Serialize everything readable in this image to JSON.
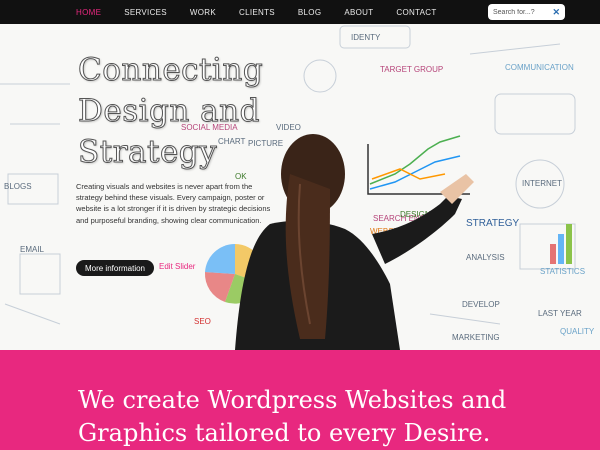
{
  "nav": {
    "items": [
      {
        "label": "HOME",
        "active": true
      },
      {
        "label": "SERVICES",
        "active": false
      },
      {
        "label": "WORK",
        "active": false
      },
      {
        "label": "CLIENTS",
        "active": false
      },
      {
        "label": "BLOG",
        "active": false
      },
      {
        "label": "ABOUT",
        "active": false
      },
      {
        "label": "CONTACT",
        "active": false
      }
    ],
    "search": {
      "placeholder": "Search for...?",
      "clear_icon": "close-icon"
    }
  },
  "hero": {
    "title": "Connecting Design and Strategy",
    "body": "Creating visuals and websites is never apart from the strategy behind these visuals. Every campaign, poster or website is a lot stronger if it is driven by strategic decisions and purposeful branding, showing clear communication.",
    "button_label": "More information",
    "edit_link": "Edit Slider",
    "whiteboard_words": {
      "identity": "IDENTY",
      "target_group": "TARGET GROUP",
      "communication": "COMMUNICATION",
      "social_media": "SOCIAL MEDIA",
      "video": "VIDEO",
      "chart": "CHART",
      "picture": "PICTURE",
      "blogs": "BLOGS",
      "ok": "OK",
      "research": "SEARCH ENGINE",
      "design": "DESIGN",
      "website": "WEBSITE",
      "strategy": "STRATEGY",
      "analysis": "ANALYSIS",
      "develop": "DEVELOP",
      "marketing": "MARKETING",
      "internet": "INTERNET",
      "statistics": "STATISTICS",
      "quality": "QUALITY",
      "seo": "SEO",
      "last_year": "LAST YEAR",
      "email": "EMAIL"
    }
  },
  "band": {
    "text": "We create Wordpress Websites and Graphics tailored to every Desire."
  },
  "colors": {
    "accent": "#e8287f",
    "nav_bg": "#111111"
  }
}
